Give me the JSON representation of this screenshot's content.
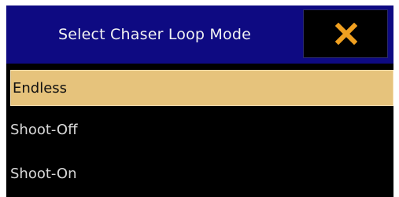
{
  "dialog": {
    "title": "Select Chaser Loop Mode",
    "close_icon": "close-x-icon",
    "colors": {
      "titlebar": "#0e0a82",
      "close_x": "#f0a020",
      "selected_bg": "#e6c37c",
      "background": "#000000"
    }
  },
  "options": [
    {
      "label": "Endless",
      "selected": true
    },
    {
      "label": "Shoot-Off",
      "selected": false
    },
    {
      "label": "Shoot-On",
      "selected": false
    }
  ]
}
